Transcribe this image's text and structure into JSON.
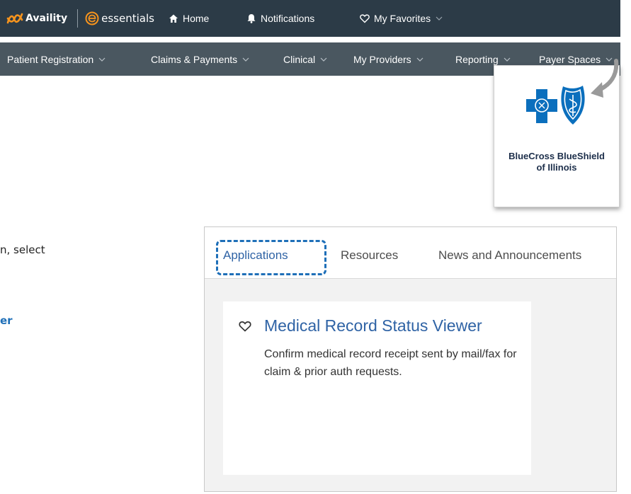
{
  "topbar": {
    "brand": "Availity",
    "product": "essentials",
    "items": [
      {
        "label": "Home",
        "icon": "home-icon"
      },
      {
        "label": "Notifications",
        "icon": "bell-icon"
      },
      {
        "label": "My Favorites",
        "icon": "heart-icon"
      }
    ]
  },
  "subnav": {
    "items": [
      {
        "label": "Patient Registration"
      },
      {
        "label": "Claims & Payments"
      },
      {
        "label": "Clinical"
      },
      {
        "label": "My Providers"
      },
      {
        "label": "Reporting"
      },
      {
        "label": "Payer Spaces"
      }
    ]
  },
  "payer_card": {
    "name_line1": "BlueCross BlueShield",
    "name_line2": "of Illinois"
  },
  "left_text": {
    "line1": "n, select",
    "link": "er"
  },
  "panel": {
    "tabs": [
      {
        "label": "Applications",
        "active": true
      },
      {
        "label": "Resources",
        "active": false
      },
      {
        "label": "News and Announcements",
        "active": false
      }
    ],
    "app": {
      "title": "Medical Record Status Viewer",
      "description": "Confirm medical record receipt sent by mail/fax for claim & prior auth requests."
    }
  },
  "colors": {
    "topbar": "#2c3b47",
    "subbar": "#4a5760",
    "accent": "#2f63a5",
    "brand_orange": "#f7941d",
    "bcbs_blue": "#0b6fbd"
  }
}
